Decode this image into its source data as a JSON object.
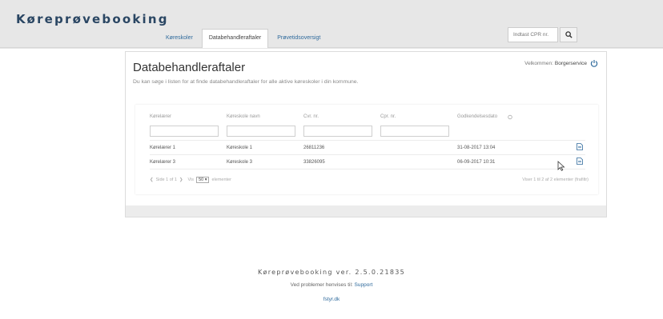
{
  "app": {
    "brand": "Køreprøvebooking"
  },
  "tabs": [
    {
      "label": "Køreskoler",
      "active": false
    },
    {
      "label": "Databehandleraftaler",
      "active": true
    },
    {
      "label": "Prøvetidsoversigt",
      "active": false
    }
  ],
  "search": {
    "placeholder": "Indtast CPR nr."
  },
  "header": {
    "title": "Databehandleraftaler",
    "description": "Du kan søge i listen for at finde databehandleraftaler for alle aktive køreskoler i din kommune.",
    "welcome_label": "Velkommen:",
    "user": "Borgerservice"
  },
  "table": {
    "columns": [
      "Kørelærer",
      "Køreskole navn",
      "Cvr. nr.",
      "Cpr. nr.",
      "Godkendelsesdato"
    ],
    "rows": [
      {
        "korelaerer": "Kørelærer 1",
        "koreskole": "Køreskole 1",
        "cvr": "26811236",
        "cpr": "",
        "dato": "31-08-2017 13:04"
      },
      {
        "korelaerer": "Kørelærer 3",
        "koreskole": "Køreskole 3",
        "cvr": "33826095",
        "cpr": "",
        "dato": "06-09-2017 10:31"
      }
    ],
    "pager": {
      "page_text": "Side 1 of 1",
      "show_label": "Vis",
      "page_size": "50",
      "items_label": "elementer",
      "summary": "Viser 1 til 2 af 2 elementer",
      "filtered": "(frafiltr)"
    }
  },
  "footer": {
    "title": "Køreprøvebooking ver. 2.5.0.21835",
    "support_text": "Ved problemer henvises til:",
    "support_link": "Support",
    "site_link": "fstyr.dk"
  },
  "colors": {
    "brand": "#2a4663",
    "link": "#2f6a9c",
    "background": "#e7e7e7"
  }
}
